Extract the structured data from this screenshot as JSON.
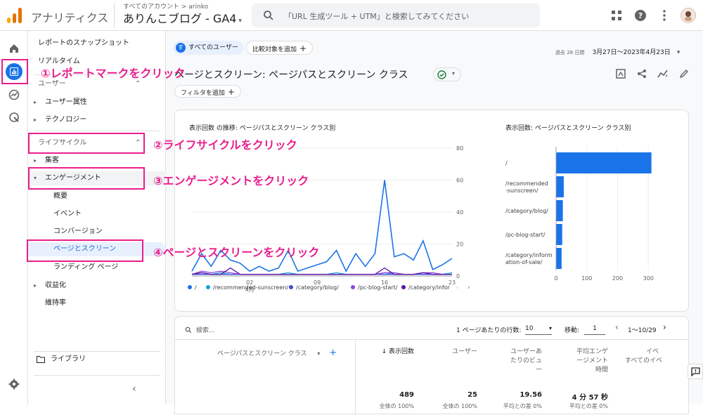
{
  "header": {
    "app_title": "アナリティクス",
    "account_path": "すべてのアカウント > arinko",
    "property": "ありんこブログ - GA4",
    "search_placeholder": "「URL 生成ツール + UTM」と検索してみてください"
  },
  "nav": {
    "snapshot": "レポートのスナップショット",
    "realtime": "リアルタイム",
    "user_section": "ユーザー",
    "user_attr": "ユーザー属性",
    "technology": "テクノロジー",
    "lifecycle": "ライフサイクル",
    "acquisition": "集客",
    "engagement": "エンゲージメント",
    "overview": "概要",
    "events": "イベント",
    "conversions": "コンバージョン",
    "pages": "ページとスクリーン",
    "landing": "ランディング ページ",
    "monetization": "収益化",
    "retention": "維持率",
    "library": "ライブラリ"
  },
  "toolbar": {
    "segment_badge": "す",
    "segment": "すべてのユーザー",
    "compare": "比較対象を追加",
    "date_prefix": "過去 28 日間",
    "date_range": "3月27日〜2023年4月23日",
    "title": "ページとスクリーン: ページパスとスクリーン クラス",
    "add_filter": "フィルタを追加"
  },
  "annotations": {
    "a1": "①レポートマークをクリック",
    "a2": "②ライフサイクルをクリック",
    "a3": "③エンゲージメントをクリック",
    "a4": "④ページとスクリーンをクリック"
  },
  "line_chart": {
    "title": "表示回数 の推移: ページパスとスクリーン クラス別",
    "y_ticks": [
      "80",
      "60",
      "40",
      "20",
      "0"
    ],
    "x_ticks": [
      "02",
      "09",
      "16",
      "23"
    ],
    "x_month": "4月",
    "legend": [
      "/",
      "/recommended-sunscreen/",
      "/category/blog/",
      "/pc-blog-start/",
      "/category/infor"
    ],
    "colors": [
      "#1a73e8",
      "#12a4d9",
      "#3c4bd6",
      "#8e44d6",
      "#5b0fa8"
    ]
  },
  "bar_chart_labels": {
    "title": "表示回数: ページパスとスクリーン クラス別",
    "x_ticks": [
      "0",
      "100",
      "200",
      "300"
    ]
  },
  "chart_data": [
    {
      "type": "line",
      "title": "表示回数 の推移: ページパスとスクリーン クラス別",
      "x": [
        "3/27",
        "3/28",
        "3/29",
        "3/30",
        "3/31",
        "4/1",
        "4/2",
        "4/3",
        "4/4",
        "4/5",
        "4/6",
        "4/7",
        "4/8",
        "4/9",
        "4/10",
        "4/11",
        "4/12",
        "4/13",
        "4/14",
        "4/15",
        "4/16",
        "4/17",
        "4/18",
        "4/19",
        "4/20",
        "4/21",
        "4/22",
        "4/23"
      ],
      "ylim": [
        0,
        80
      ],
      "series": [
        {
          "name": "/",
          "values": [
            3,
            14,
            6,
            16,
            10,
            8,
            3,
            6,
            3,
            5,
            16,
            3,
            5,
            7,
            9,
            16,
            3,
            14,
            6,
            14,
            60,
            12,
            14,
            10,
            22,
            4,
            7,
            11
          ]
        },
        {
          "name": "/recommended-sunscreen/",
          "values": [
            1,
            2,
            1,
            2,
            1,
            1,
            1,
            1,
            1,
            1,
            2,
            1,
            1,
            1,
            1,
            2,
            1,
            1,
            1,
            1,
            2,
            1,
            1,
            1,
            2,
            1,
            1,
            2
          ]
        },
        {
          "name": "/category/blog/",
          "values": [
            1,
            1,
            1,
            1,
            1,
            1,
            1,
            1,
            1,
            1,
            1,
            1,
            1,
            1,
            1,
            1,
            1,
            1,
            1,
            1,
            1,
            1,
            1,
            1,
            1,
            1,
            1,
            1
          ]
        },
        {
          "name": "/pc-blog-start/",
          "values": [
            1,
            3,
            2,
            3,
            2,
            1,
            1,
            1,
            1,
            1,
            1,
            1,
            1,
            1,
            1,
            1,
            1,
            1,
            1,
            1,
            2,
            2,
            1,
            1,
            2,
            2,
            1,
            1
          ]
        },
        {
          "name": "/category/infor",
          "values": [
            1,
            2,
            1,
            1,
            5,
            1,
            1,
            1,
            1,
            1,
            1,
            1,
            1,
            1,
            1,
            1,
            1,
            1,
            1,
            1,
            5,
            1,
            1,
            1,
            2,
            1,
            1,
            1
          ]
        }
      ]
    },
    {
      "type": "bar",
      "title": "表示回数: ページパスとスクリーン クラス別",
      "categories": [
        "/",
        "/recommended-sunscreen/",
        "/category/blog/",
        "/pc-blog-start/",
        "/category/information-of-sale/"
      ],
      "values": [
        310,
        25,
        22,
        20,
        18
      ],
      "xlim": [
        0,
        320
      ]
    }
  ],
  "bar_labels_display": [
    [
      "/"
    ],
    [
      "/recommended",
      "-sunscreen/"
    ],
    [
      "/category/blog/"
    ],
    [
      "/pc-blog-start/"
    ],
    [
      "/category/inform",
      "ation-of-sale/"
    ]
  ],
  "table": {
    "search_placeholder": "検索...",
    "rows_per_page_label": "1 ページあたりの行数:",
    "rows_per_page": "10",
    "goto_label": "移動:",
    "goto_value": "1",
    "range": "1〜10/29",
    "dimension_header": "ページパスとスクリーン クラス",
    "col1": "↓ 表示回数",
    "col2": "ユーザー",
    "col3a": "ユーザーあ",
    "col3b": "たりのビュ",
    "col3c": "ー",
    "col4a": "平均エンゲ",
    "col4b": "ージメント",
    "col4c": "時間",
    "col5a": "イベ",
    "col5b": "すべてのイベ",
    "tot1": "489",
    "tot2": "25",
    "tot3": "19.56",
    "tot4": "4 分 57 秒",
    "sub1": "全体の 100%",
    "sub2": "全体の 100%",
    "sub3": "平均との差 0%",
    "sub4": "平均との差 0%"
  }
}
